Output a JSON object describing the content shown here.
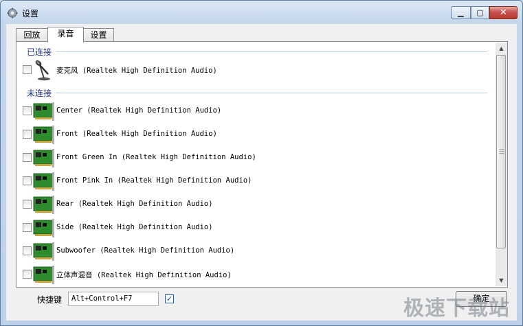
{
  "window": {
    "title": "设置"
  },
  "tabs": [
    {
      "label": "回放",
      "active": false
    },
    {
      "label": "录音",
      "active": true
    },
    {
      "label": "设置",
      "active": false
    }
  ],
  "groups": {
    "connected": {
      "label": "已连接"
    },
    "disconnected": {
      "label": "未连接"
    }
  },
  "devices": {
    "connected": [
      {
        "label": "麦克风 (Realtek High Definition Audio)",
        "icon": "microphone-icon",
        "checked": false
      }
    ],
    "disconnected": [
      {
        "label": "Center (Realtek High Definition Audio)",
        "icon": "sound-card-icon",
        "checked": false
      },
      {
        "label": "Front (Realtek High Definition Audio)",
        "icon": "sound-card-icon",
        "checked": false
      },
      {
        "label": "Front Green In (Realtek High Definition Audio)",
        "icon": "sound-card-icon",
        "checked": false
      },
      {
        "label": "Front Pink In (Realtek High Definition Audio)",
        "icon": "sound-card-icon",
        "checked": false
      },
      {
        "label": "Rear (Realtek High Definition Audio)",
        "icon": "sound-card-icon",
        "checked": false
      },
      {
        "label": "Side (Realtek High Definition Audio)",
        "icon": "sound-card-icon",
        "checked": false
      },
      {
        "label": "Subwoofer (Realtek High Definition Audio)",
        "icon": "sound-card-icon",
        "checked": false
      },
      {
        "label": "立体声混音 (Realtek High Definition Audio)",
        "icon": "sound-card-icon",
        "checked": false
      }
    ]
  },
  "hotkey": {
    "label": "快捷键",
    "value": "Alt+Control+F7",
    "enabled": true
  },
  "buttons": {
    "ok_label": "确定"
  },
  "watermark": {
    "text": "极速下载站"
  },
  "colors": {
    "group_text": "#1e3287",
    "card_green": "#2e8b2e"
  }
}
